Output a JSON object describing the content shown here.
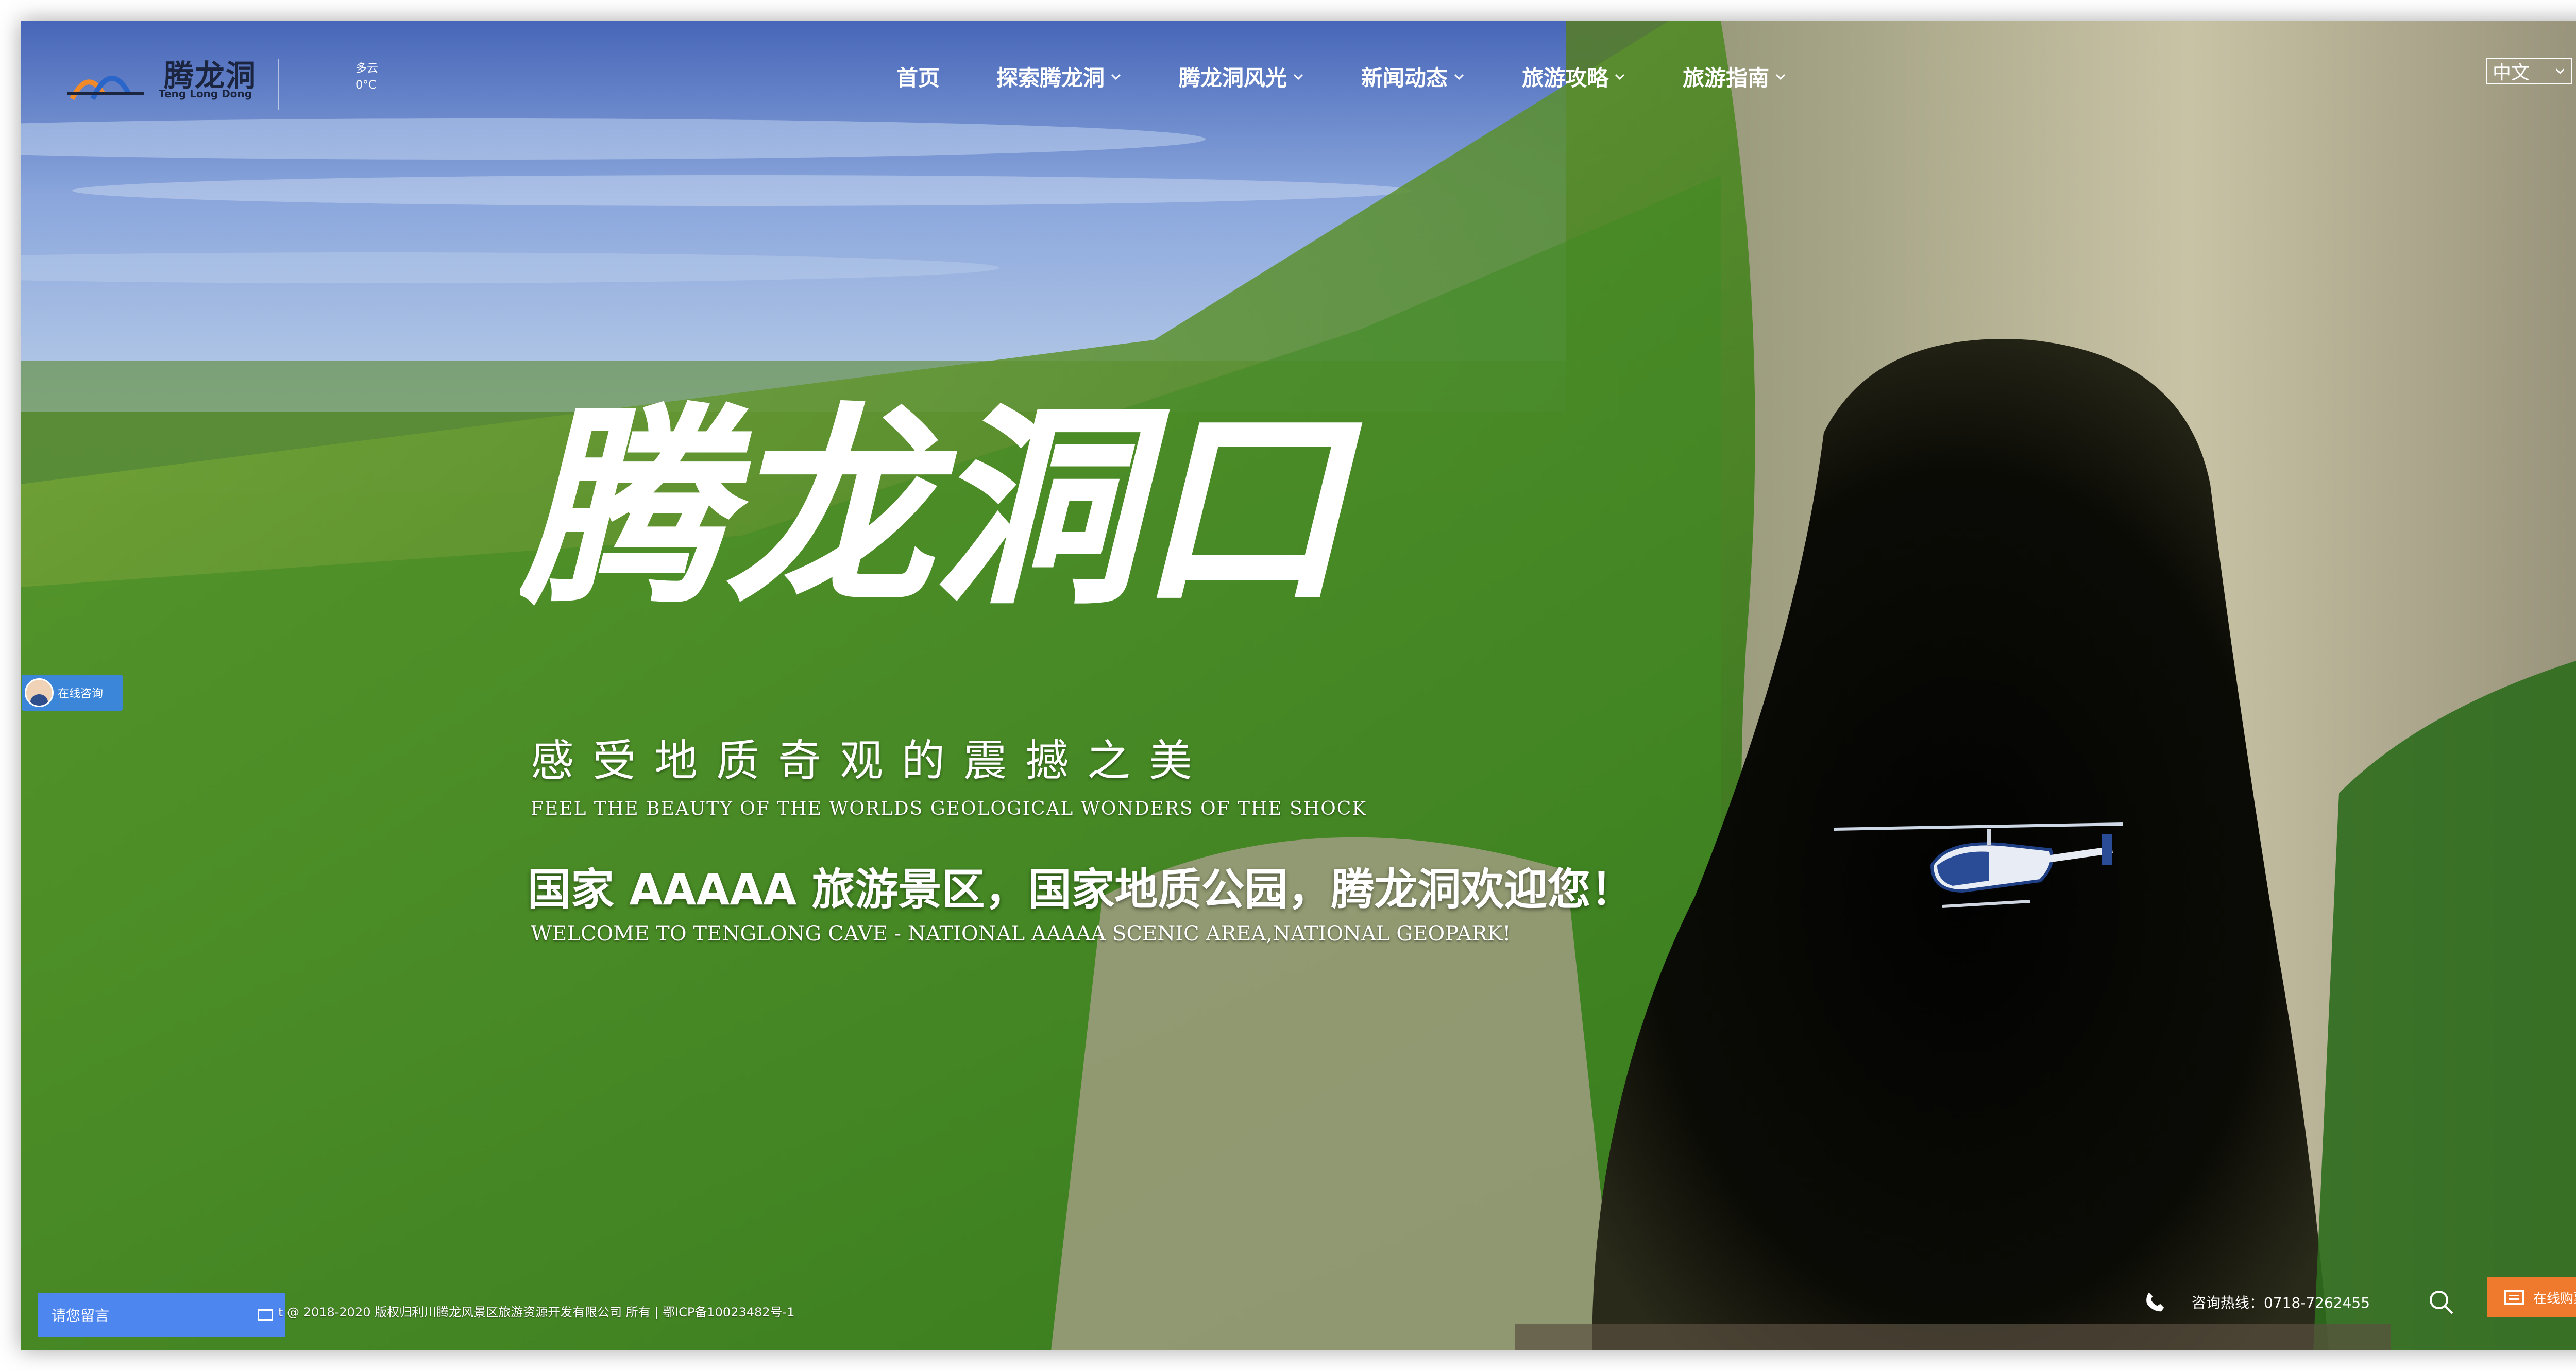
{
  "header": {
    "logo_cn": "腾龙洞",
    "logo_en": "Teng Long Dong",
    "weather": {
      "condition": "多云",
      "temperature": "0°C"
    },
    "nav": [
      {
        "label": "首页",
        "has_dropdown": false
      },
      {
        "label": "探索腾龙洞",
        "has_dropdown": true
      },
      {
        "label": "腾龙洞风光",
        "has_dropdown": true
      },
      {
        "label": "新闻动态",
        "has_dropdown": true
      },
      {
        "label": "旅游攻略",
        "has_dropdown": true
      },
      {
        "label": "旅游指南",
        "has_dropdown": true
      }
    ],
    "language": "中文"
  },
  "hero": {
    "calligraphy": "腾龙洞口",
    "tagline_cn": "感受地质奇观的震撼之美",
    "tagline_en": "FEEL THE BEAUTY OF THE WORLDS GEOLOGICAL WONDERS OF THE SHOCK",
    "welcome_cn": "国家 AAAAA 旅游景区，国家地质公园，腾龙洞欢迎您！",
    "welcome_en": "WELCOME TO TENGLONG CAVE - NATIONAL AAAAA SCENIC AREA,NATIONAL GEOPARK!"
  },
  "widgets": {
    "online_consult": "在线咨询",
    "leave_message": "请您留言"
  },
  "footer": {
    "copyright": "t @ 2018-2020 版权归利川腾龙风景区旅游资源开发有限公司 所有 | 鄂ICP备10023482号-1",
    "hotline": "咨询热线：0718-7262455",
    "buy_button": "在线购票"
  },
  "colors": {
    "accent_orange": "#ef7a2e",
    "message_blue": "#4e86f0",
    "consult_blue": "#3b86d8"
  }
}
